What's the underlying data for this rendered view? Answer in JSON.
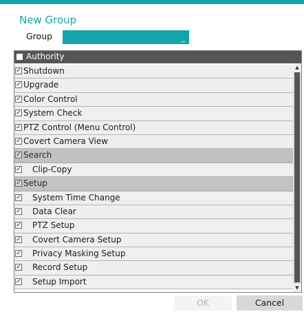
{
  "dialog": {
    "title": "New Group",
    "group_label": "Group",
    "group_value": ""
  },
  "authority": {
    "header": "Authority",
    "items": [
      {
        "label": "Shutdown",
        "checked": true
      },
      {
        "label": "Upgrade",
        "checked": true
      },
      {
        "label": "Color Control",
        "checked": true
      },
      {
        "label": "System Check",
        "checked": true
      },
      {
        "label": "PTZ Control (Menu Control)",
        "checked": true
      },
      {
        "label": "Covert Camera View",
        "checked": true
      },
      {
        "label": "Search",
        "checked": true,
        "section": true
      },
      {
        "label": "Clip-Copy",
        "checked": true,
        "sub": true
      },
      {
        "label": "Setup",
        "checked": true,
        "section": true
      },
      {
        "label": "System Time Change",
        "checked": true,
        "sub": true
      },
      {
        "label": "Data Clear",
        "checked": true,
        "sub": true
      },
      {
        "label": "PTZ Setup",
        "checked": true,
        "sub": true
      },
      {
        "label": "Covert Camera Setup",
        "checked": true,
        "sub": true
      },
      {
        "label": "Privacy Masking Setup",
        "checked": true,
        "sub": true
      },
      {
        "label": "Record Setup",
        "checked": true,
        "sub": true
      },
      {
        "label": "Setup Import",
        "checked": true,
        "sub": true
      }
    ]
  },
  "buttons": {
    "ok": "OK",
    "cancel": "Cancel"
  },
  "colors": {
    "accent": "#14a5aa",
    "header_bg": "#555555",
    "section_bg": "#c2c2c2"
  },
  "icons": {
    "checkbox": "checkmark-icon",
    "scroll_up": "scroll-up-arrow-icon",
    "scroll_down": "scroll-down-arrow-icon"
  }
}
